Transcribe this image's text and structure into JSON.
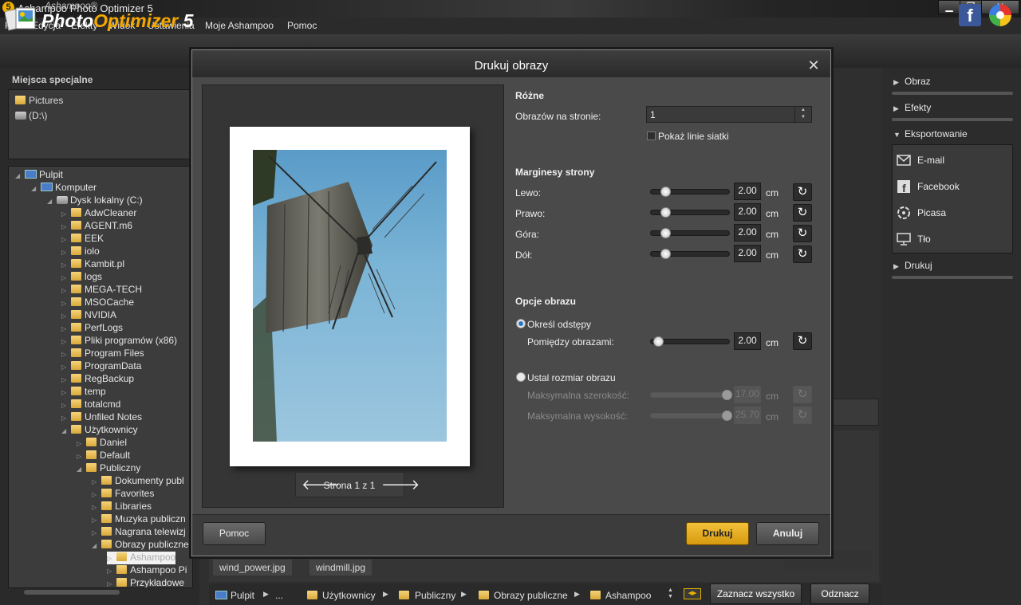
{
  "window": {
    "title": "Ashampoo Photo Optimizer 5",
    "icon_text": "5"
  },
  "menu": [
    "Plik",
    "Edycja",
    "Efekty",
    "Widok",
    "Ustawienia",
    "Moje Ashampoo",
    "Pomoc"
  ],
  "header": {
    "brand": "Ashampoo®",
    "product_a": "Photo",
    "product_b": "Optimizer",
    "version": "5"
  },
  "left": {
    "special_title": "Miejsca specjalne",
    "special_items": [
      "Pictures",
      "(D:\\)"
    ],
    "tree": [
      "Pulpit",
      "Komputer",
      "Dysk lokalny (C:)",
      "AdwCleaner",
      "AGENT.m6",
      "EEK",
      "iolo",
      "Kambit.pl",
      "logs",
      "MEGA-TECH",
      "MSOCache",
      "NVIDIA",
      "PerfLogs",
      "Pliki programów (x86)",
      "Program Files",
      "ProgramData",
      "RegBackup",
      "temp",
      "totalcmd",
      "Unfiled Notes",
      "Użytkownicy",
      "Daniel",
      "Default",
      "Publiczny",
      "Dokumenty publ",
      "Favorites",
      "Libraries",
      "Muzyka publiczn",
      "Nagrana telewizj",
      "Obrazy publiczne",
      "Ashampoo",
      "Ashampoo Pi",
      "Przykładowe"
    ]
  },
  "right": {
    "obraz": "Obraz",
    "efekty": "Efekty",
    "eksportowanie": "Eksportowanie",
    "export_items": [
      "E-mail",
      "Facebook",
      "Picasa",
      "Tło"
    ],
    "drukuj": "Drukuj"
  },
  "thumbs": [
    "wind_power.jpg",
    "windmill.jpg"
  ],
  "breadcrumb": [
    "Pulpit",
    "...",
    "Użytkownicy",
    "Publiczny",
    "Obrazy publiczne",
    "Ashampoo"
  ],
  "bottom_buttons": {
    "select_all": "Zaznacz wszystko",
    "deselect": "Odznacz"
  },
  "dialog": {
    "title": "Drukuj obrazy",
    "page_label": "Strona 1 z 1",
    "rozne": {
      "title": "Różne",
      "per_page_label": "Obrazów na stronie:",
      "per_page_value": "1",
      "grid_label": "Pokaż linie siatki",
      "grid_checked": false
    },
    "margins": {
      "title": "Marginesy strony",
      "rows": [
        {
          "label": "Lewo:",
          "value": "2.00",
          "unit": "cm"
        },
        {
          "label": "Prawo:",
          "value": "2.00",
          "unit": "cm"
        },
        {
          "label": "Góra:",
          "value": "2.00",
          "unit": "cm"
        },
        {
          "label": "Dół:",
          "value": "2.00",
          "unit": "cm"
        }
      ]
    },
    "image_options": {
      "title": "Opcje obrazu",
      "spacing_radio": "Określ odstępy",
      "spacing_label": "Pomiędzy obrazami:",
      "spacing_value": "2.00",
      "spacing_unit": "cm",
      "size_radio": "Ustal rozmiar obrazu",
      "max_width_label": "Maksymalna szerokość:",
      "max_width_value": "17.00",
      "max_height_label": "Maksymalna wysokość:",
      "max_height_value": "25.70",
      "unit": "cm",
      "selected": "spacing"
    },
    "buttons": {
      "help": "Pomoc",
      "print": "Drukuj",
      "cancel": "Anuluj"
    }
  }
}
